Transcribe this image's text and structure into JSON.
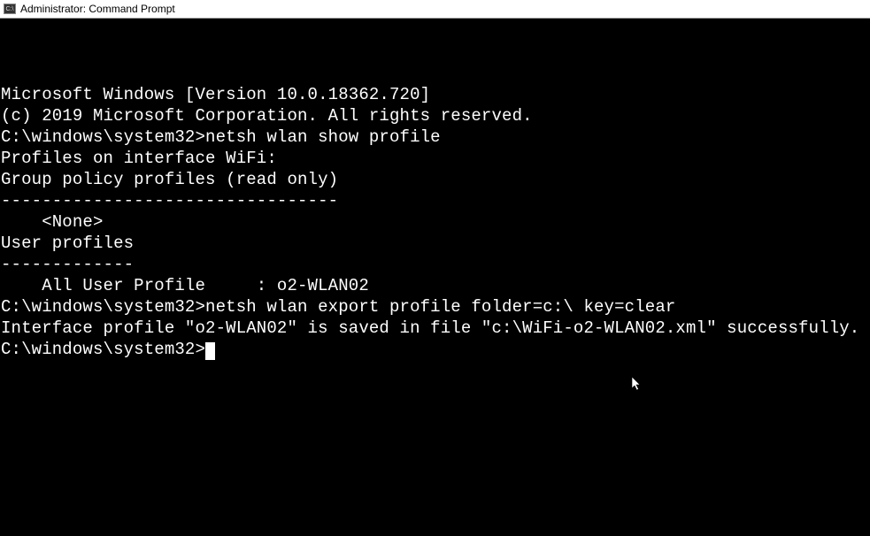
{
  "titlebar": {
    "icon_label": "C:\\",
    "title": "Administrator: Command Prompt"
  },
  "terminal": {
    "lines": [
      "Microsoft Windows [Version 10.0.18362.720]",
      "(c) 2019 Microsoft Corporation. All rights reserved.",
      "",
      "C:\\windows\\system32>netsh wlan show profile",
      "",
      "Profiles on interface WiFi:",
      "",
      "Group policy profiles (read only)",
      "---------------------------------",
      "    <None>",
      "",
      "User profiles",
      "-------------",
      "    All User Profile     : o2-WLAN02",
      "",
      "",
      "C:\\windows\\system32>netsh wlan export profile folder=c:\\ key=clear",
      "",
      "Interface profile \"o2-WLAN02\" is saved in file \"c:\\WiFi-o2-WLAN02.xml\" successfully.",
      "",
      "",
      "C:\\windows\\system32>"
    ],
    "cursor_line_index": 21
  }
}
